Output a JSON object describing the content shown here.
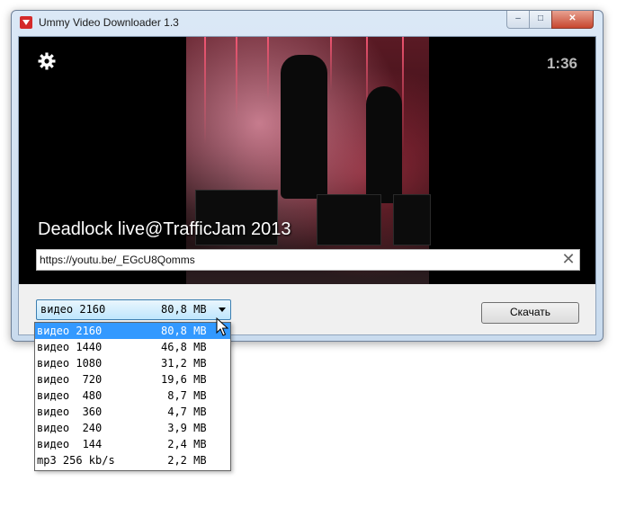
{
  "window": {
    "title": "Ummy Video Downloader 1.3",
    "controls": {
      "minimize": "–",
      "maximize": "□",
      "close": "✕"
    }
  },
  "video": {
    "duration": "1:36",
    "title": "Deadlock live@TrafficJam 2013"
  },
  "url": {
    "value": "https://youtu.be/_EGcU8Qomms"
  },
  "quality": {
    "selected_label": "видео 2160",
    "selected_size": "80,8 MB",
    "options": [
      {
        "label": "видео 2160",
        "size": "80,8 MB"
      },
      {
        "label": "видео 1440",
        "size": "46,8 MB"
      },
      {
        "label": "видео 1080",
        "size": "31,2 MB"
      },
      {
        "label": "видео  720",
        "size": "19,6 MB"
      },
      {
        "label": "видео  480",
        "size": " 8,7 MB"
      },
      {
        "label": "видео  360",
        "size": " 4,7 MB"
      },
      {
        "label": "видео  240",
        "size": " 3,9 MB"
      },
      {
        "label": "видео  144",
        "size": " 2,4 MB"
      },
      {
        "label": "mp3 256 kb/s",
        "size": " 2,2 MB"
      }
    ]
  },
  "download_label": "Скачать",
  "colors": {
    "selection": "#3399ff",
    "close_button": "#c7472f"
  }
}
